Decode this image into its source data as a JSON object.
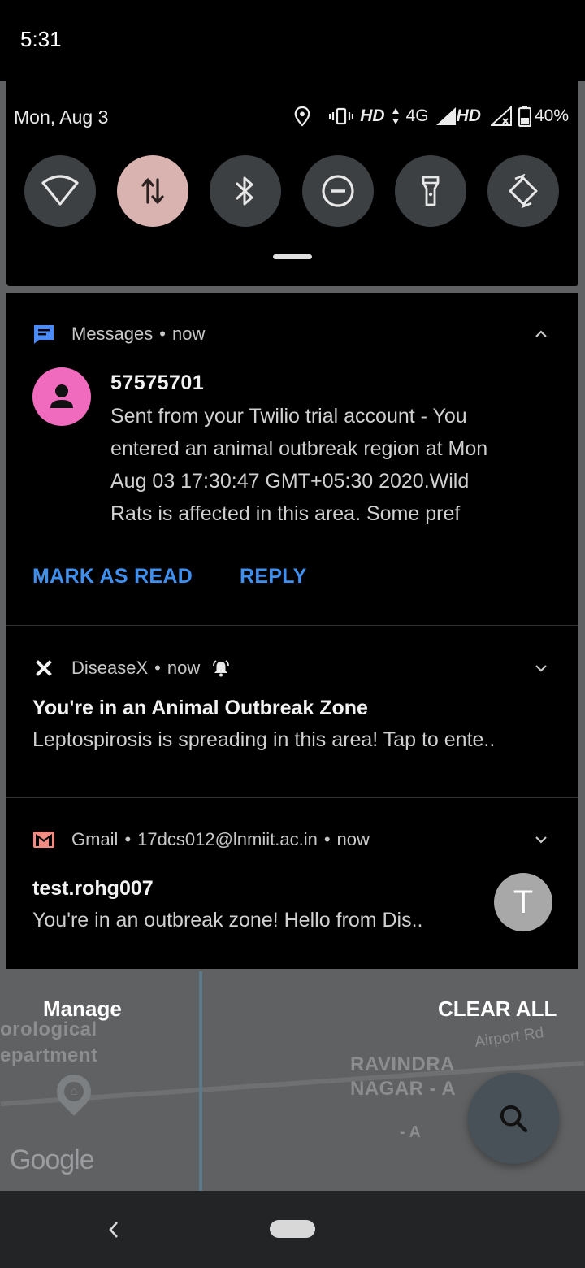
{
  "status_bar": {
    "time": "5:31"
  },
  "shade": {
    "date": "Mon, Aug 3",
    "hd1": "HD",
    "net": "4G",
    "hd2": "HD",
    "battery": "40%",
    "tiles": [
      {
        "name": "wifi",
        "active": false
      },
      {
        "name": "mobile-data",
        "active": true
      },
      {
        "name": "bluetooth",
        "active": false
      },
      {
        "name": "do-not-disturb",
        "active": false
      },
      {
        "name": "flashlight",
        "active": false
      },
      {
        "name": "auto-rotate",
        "active": false
      }
    ]
  },
  "notifications": {
    "messages": {
      "app": "Messages",
      "time": "now",
      "sender": "57575701",
      "lines": [
        "Sent from your Twilio trial account - You",
        "entered an animal outbreak region at Mon",
        "Aug 03 17:30:47 GMT+05:30 2020.Wild",
        "Rats is affected in this area. Some pref"
      ],
      "action_read": "MARK AS READ",
      "action_reply": "REPLY"
    },
    "diseasex": {
      "app": "DiseaseX",
      "time": "now",
      "title": "You're in an Animal Outbreak Zone",
      "text": "Leptospirosis is spreading in this area! Tap to ente.."
    },
    "gmail": {
      "app": "Gmail",
      "account": "17dcs012@lnmiit.ac.in",
      "time": "now",
      "sender": "test.rohg007",
      "text": "You're in an outbreak zone! Hello from Dis..",
      "avatar_letter": "T"
    }
  },
  "footer": {
    "manage": "Manage",
    "clear_all": "CLEAR ALL"
  },
  "map": {
    "label_dept_1": "orological",
    "label_dept_2": "epartment",
    "label_area_1": "RAVINDRA",
    "label_area_2": "NAGAR - A",
    "label_a": "- A",
    "label_road": "Airport Rd",
    "google": "Google"
  },
  "colors": {
    "accent_blue": "#3f8fef",
    "active_tile": "#d9b3b0",
    "avatar_pink": "#f06bbd"
  }
}
